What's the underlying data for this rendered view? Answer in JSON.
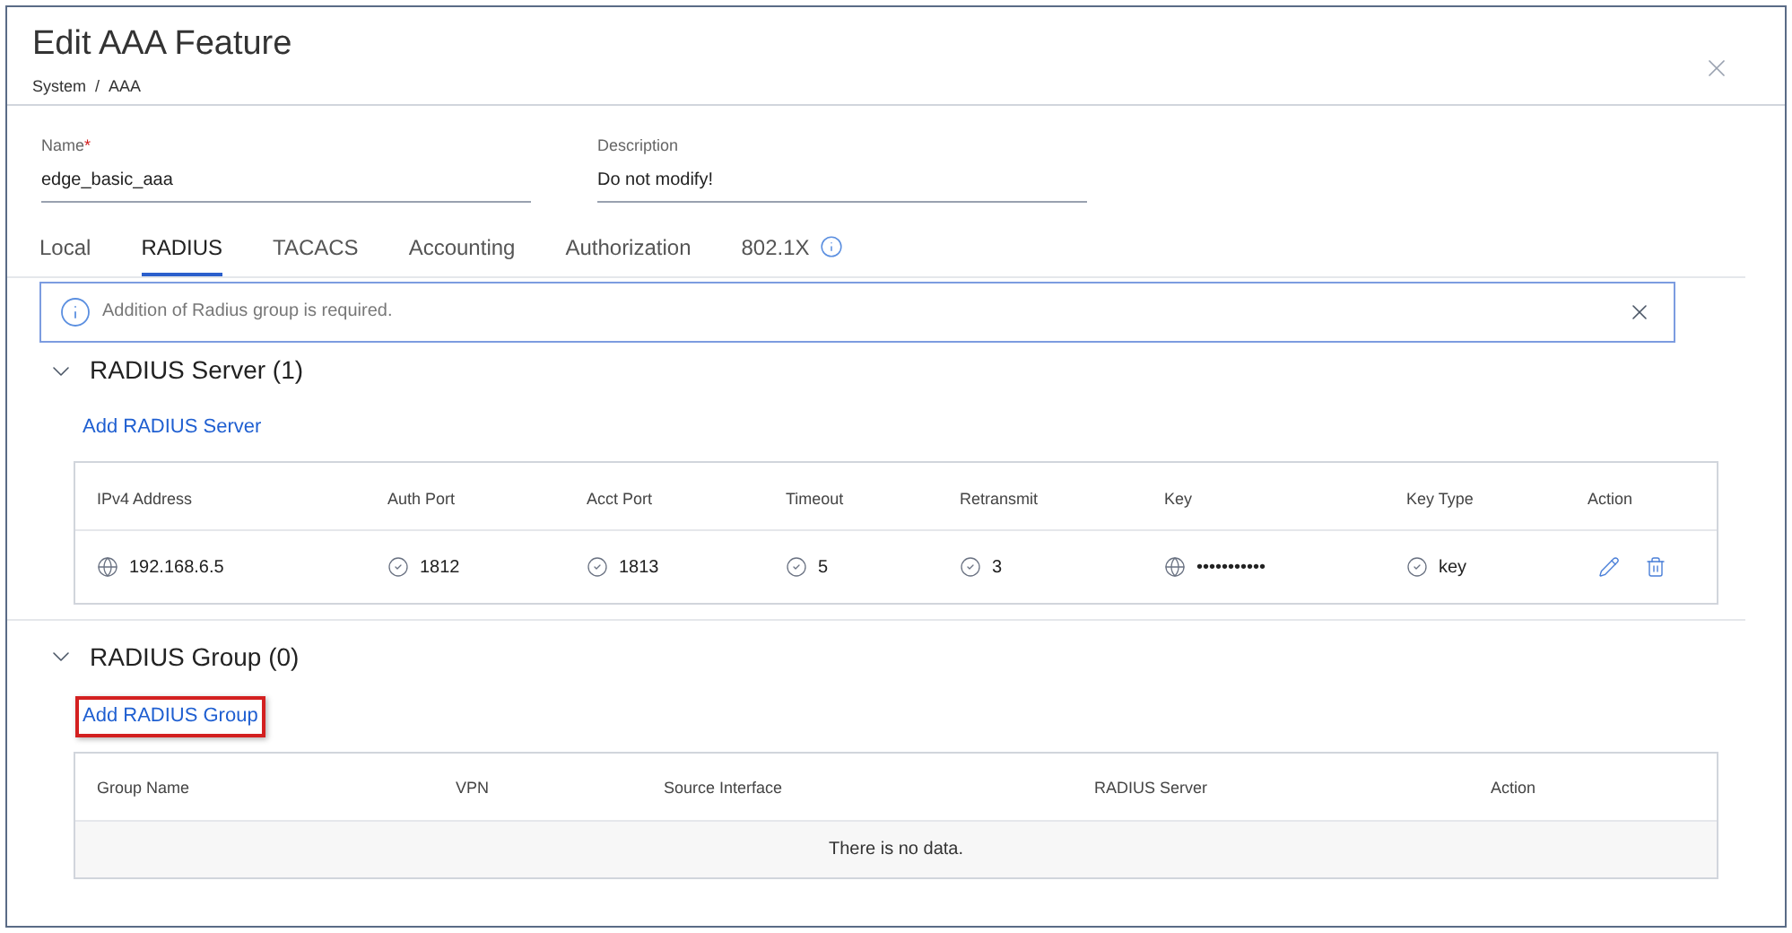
{
  "window": {
    "title": "Edit AAA Feature",
    "breadcrumb": [
      "System",
      "AAA"
    ],
    "breadcrumb_separator": "/"
  },
  "fields": [
    {
      "label": "Name",
      "required_mark": "*",
      "value": "edge_basic_aaa"
    },
    {
      "label": "Description",
      "value": "Do not modify!"
    }
  ],
  "tabs": [
    {
      "label": "Local",
      "selected": false,
      "info": false
    },
    {
      "label": "RADIUS",
      "selected": true,
      "info": false
    },
    {
      "label": "TACACS",
      "selected": false,
      "info": false
    },
    {
      "label": "Accounting",
      "selected": false,
      "info": false
    },
    {
      "label": "Authorization",
      "selected": false,
      "info": false
    },
    {
      "label": "802.1X",
      "selected": false,
      "info": true
    }
  ],
  "alert": {
    "message": "Addition of Radius group is required."
  },
  "server_section": {
    "title": "RADIUS Server (1)",
    "expanded": true,
    "add_link": {
      "label": "Add RADIUS Server",
      "highlighted": false
    },
    "columns": [
      "IPv4 Address",
      "Auth Port",
      "Acct Port",
      "Timeout",
      "Retransmit",
      "Key",
      "Key Type",
      "Action"
    ],
    "rows": [
      {
        "cells": [
          "192.168.6.5",
          "1812",
          "1813",
          "5",
          "3",
          "•••••••••••",
          "key"
        ]
      }
    ]
  },
  "group_section": {
    "title": "RADIUS Group (0)",
    "expanded": true,
    "add_link": {
      "label": "Add RADIUS Group",
      "highlighted": true
    },
    "columns": [
      "Group Name",
      "VPN",
      "Source Interface",
      "RADIUS Server",
      "Action"
    ],
    "empty_text": "There is no data."
  }
}
